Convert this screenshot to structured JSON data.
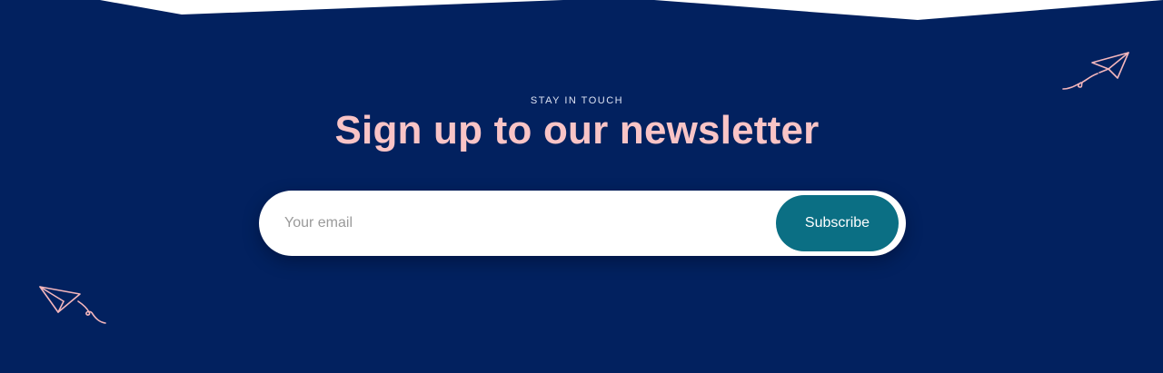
{
  "newsletter": {
    "eyebrow": "STAY IN TOUCH",
    "headline": "Sign up to our newsletter",
    "email_placeholder": "Your email",
    "email_value": "",
    "subscribe_label": "Subscribe"
  },
  "icons": {
    "decoration_top_right": "paper-plane-icon",
    "decoration_bottom_left": "paper-plane-icon"
  },
  "colors": {
    "background": "#02215f",
    "headline": "#f9c4c6",
    "button": "#0b6f84",
    "plane_stroke": "#f4b6bc"
  }
}
